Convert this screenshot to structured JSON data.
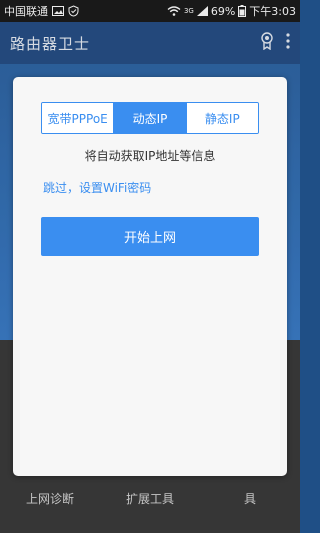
{
  "status_bar": {
    "carrier": "中国联通",
    "network": "3G",
    "battery": "69%",
    "time": "下午3:03"
  },
  "app_bar": {
    "title": "路由器卫士"
  },
  "bottom_nav": {
    "items": [
      {
        "label": "上网诊断"
      },
      {
        "label": "扩展工具"
      },
      {
        "label": "具"
      }
    ]
  },
  "dialog": {
    "tabs": [
      {
        "label": "宽带PPPoE",
        "active": false
      },
      {
        "label": "动态IP",
        "active": true
      },
      {
        "label": "静态IP",
        "active": false
      }
    ],
    "description": "将自动获取IP地址等信息",
    "skip_link": "跳过，设置WiFi密码",
    "start_button": "开始上网"
  },
  "colors": {
    "accent": "#3a8ef0",
    "app_bar": "#274f86",
    "status_bar": "#1c1c1c"
  }
}
